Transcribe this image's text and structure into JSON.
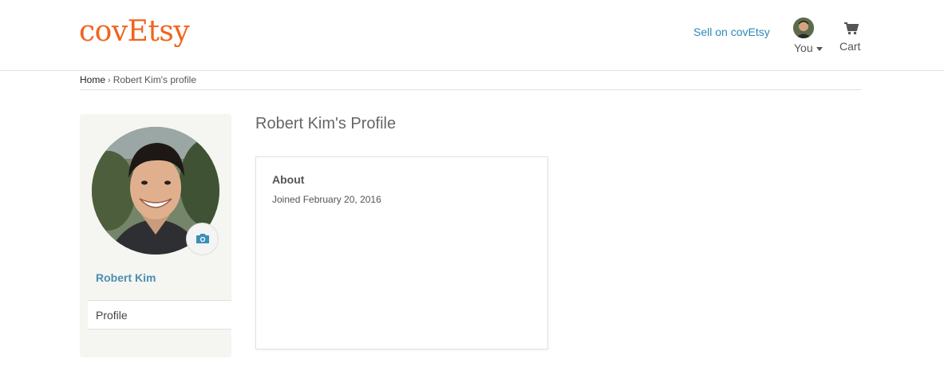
{
  "header": {
    "logo": "covEtsy",
    "sell_link": "Sell on covEtsy",
    "you_label": "You",
    "cart_label": "Cart"
  },
  "breadcrumb": {
    "home": "Home",
    "separator": "›",
    "current": "Robert Kim's profile"
  },
  "sidebar": {
    "name": "Robert Kim",
    "tabs": [
      {
        "label": "Profile"
      }
    ]
  },
  "main": {
    "title": "Robert Kim's Profile",
    "about": {
      "heading": "About",
      "joined": "Joined February 20, 2016"
    }
  },
  "colors": {
    "brand": "#f1641e",
    "link": "#2a8ab7",
    "sidebar_bg": "#f5f5f1"
  },
  "icons": {
    "camera": "camera-icon",
    "cart": "cart-icon",
    "caret": "chevron-down-icon"
  }
}
